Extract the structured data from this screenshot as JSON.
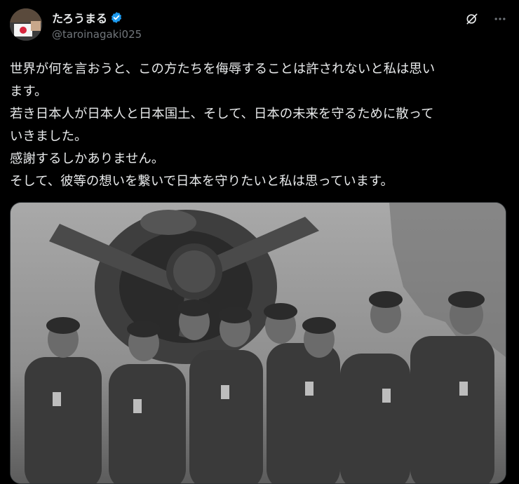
{
  "author": {
    "display_name": "たろうまる",
    "handle": "@taroinagaki025",
    "verified": true,
    "avatar_icon": "avatar-with-japan-flag-icon"
  },
  "header_actions": [
    {
      "icon": "grok-icon"
    },
    {
      "icon": "more-icon",
      "label": "···"
    }
  ],
  "tweet": {
    "lines": [
      "世界が何を言おうと、この方たちを侮辱することは許されないと私は思い",
      "ます。",
      "若き日本人が日本人と日本国土、そして、日本の未来を守るために散って",
      "いきました。",
      "感謝するしかありません。",
      "そして、彼等の想いを繋いで日本を守りたいと私は思っています。"
    ]
  },
  "media": {
    "icon": "black-and-white-photo"
  },
  "colors": {
    "background": "#000000",
    "text": "#e7e9ea",
    "secondary_text": "#71767b",
    "verified": "#1d9bf0"
  }
}
